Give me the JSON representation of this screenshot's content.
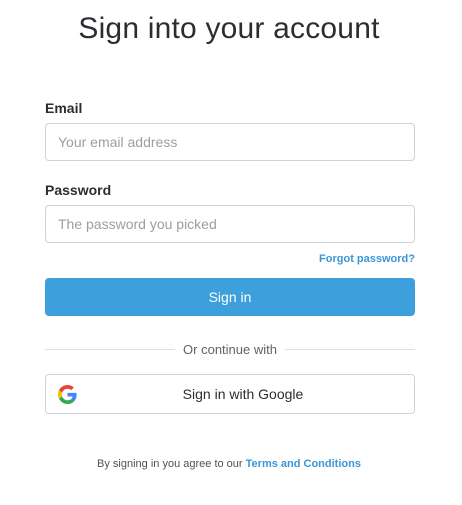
{
  "page": {
    "title": "Sign into your account"
  },
  "form": {
    "email": {
      "label": "Email",
      "placeholder": "Your email address",
      "value": ""
    },
    "password": {
      "label": "Password",
      "placeholder": "The password you picked",
      "value": ""
    },
    "forgot_password": "Forgot password?",
    "submit_label": "Sign in"
  },
  "divider": {
    "text": "Or continue with"
  },
  "social": {
    "google_label": "Sign in with Google",
    "google_icon": "google-g-icon"
  },
  "footer": {
    "terms_prefix": "By signing in you agree to our",
    "terms_link": "Terms and Conditions"
  },
  "colors": {
    "accent": "#3d9fdc",
    "link": "#3a96d6",
    "text": "#2b2d33",
    "border": "#cfd3d8"
  }
}
